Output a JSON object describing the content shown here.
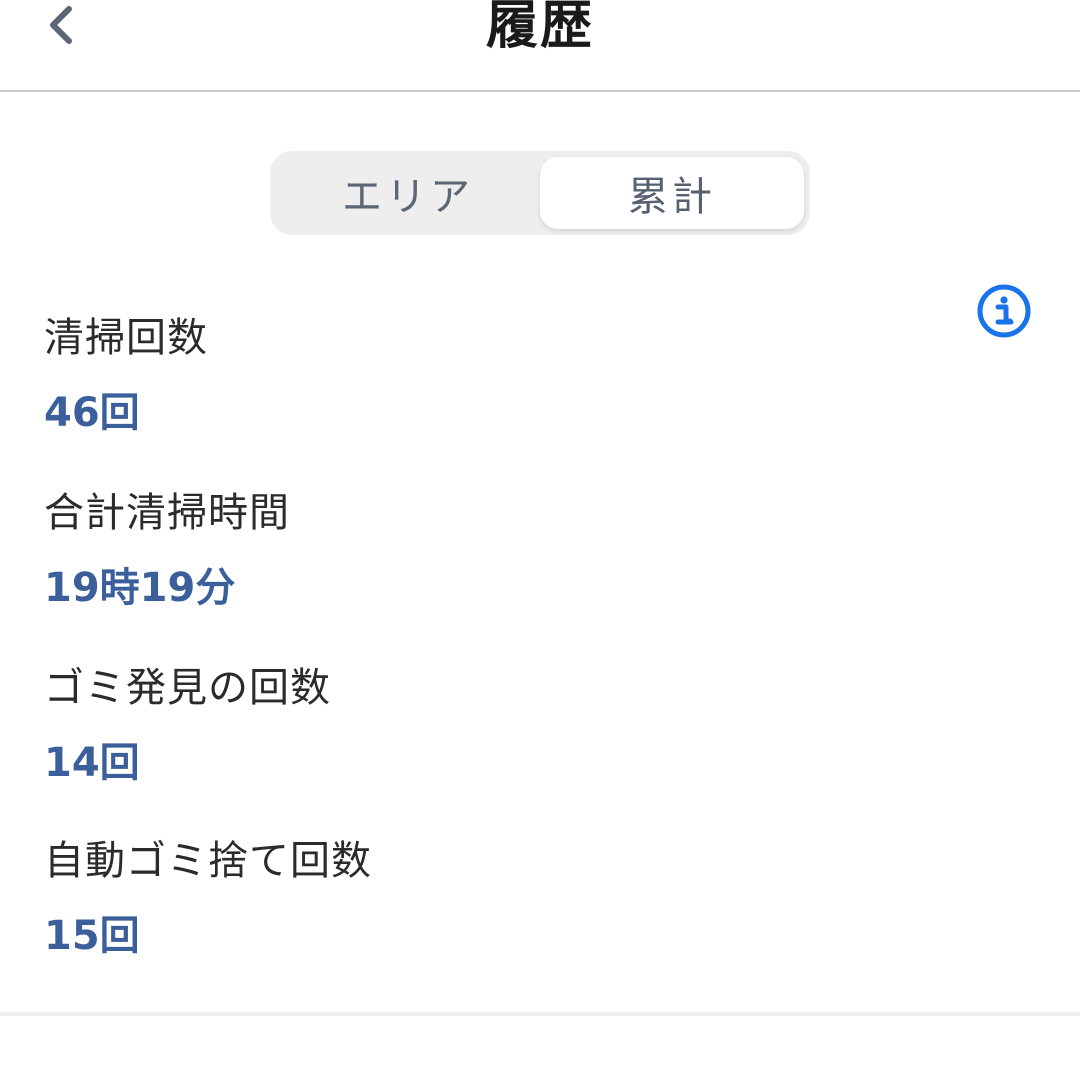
{
  "header": {
    "title": "履歴",
    "back_icon": "chevron-left-icon"
  },
  "tabs": [
    {
      "label": "エリア",
      "active": false
    },
    {
      "label": "累計",
      "active": true
    }
  ],
  "info_icon": "info-icon",
  "colors": {
    "accent_value": "#3b5f9a",
    "info_blue": "#1a73e8",
    "back_gray": "#5b6677"
  },
  "stats": [
    {
      "label": "清掃回数",
      "value": "46回"
    },
    {
      "label": "合計清掃時間",
      "value": "19時19分"
    },
    {
      "label": "ゴミ発見の回数",
      "value": "14回"
    },
    {
      "label": "自動ゴミ捨て回数",
      "value": "15回"
    }
  ]
}
